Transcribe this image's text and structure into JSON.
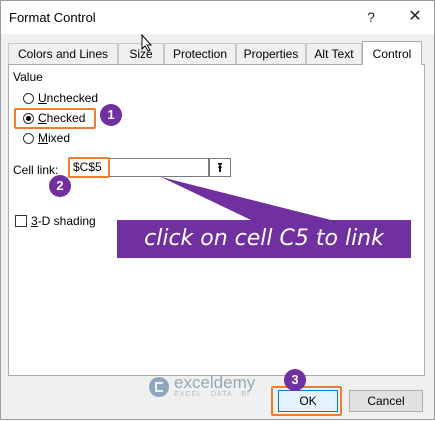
{
  "dialog": {
    "title": "Format Control",
    "help_label": "?",
    "close_label": "✕"
  },
  "tabs": [
    {
      "label": "Colors and Lines",
      "active": false
    },
    {
      "label": "Size",
      "active": false
    },
    {
      "label": "Protection",
      "active": false
    },
    {
      "label": "Properties",
      "active": false
    },
    {
      "label": "Alt Text",
      "active": false
    },
    {
      "label": "Control",
      "active": true
    }
  ],
  "value_section": {
    "label": "Value",
    "options": [
      {
        "accel": "U",
        "rest": "nchecked",
        "selected": false
      },
      {
        "accel": "C",
        "rest": "hecked",
        "selected": true
      },
      {
        "accel": "M",
        "rest": "ixed",
        "selected": false
      }
    ]
  },
  "cell_link": {
    "label": "Cell link:",
    "value": "$C$5",
    "collapse_icon": "collapse-dialog-icon"
  },
  "shading": {
    "accel": "3",
    "rest": "-D shading",
    "checked": false
  },
  "annotations": {
    "badge_1": "1",
    "badge_2": "2",
    "badge_3": "3",
    "callout": "click on cell C5 to link",
    "accent_color": "#7030a0",
    "highlight_color": "#ed7d31"
  },
  "watermark": {
    "name": "exceldemy",
    "sub": "EXCEL · DATA · BI"
  },
  "buttons": {
    "ok": "OK",
    "cancel": "Cancel"
  }
}
